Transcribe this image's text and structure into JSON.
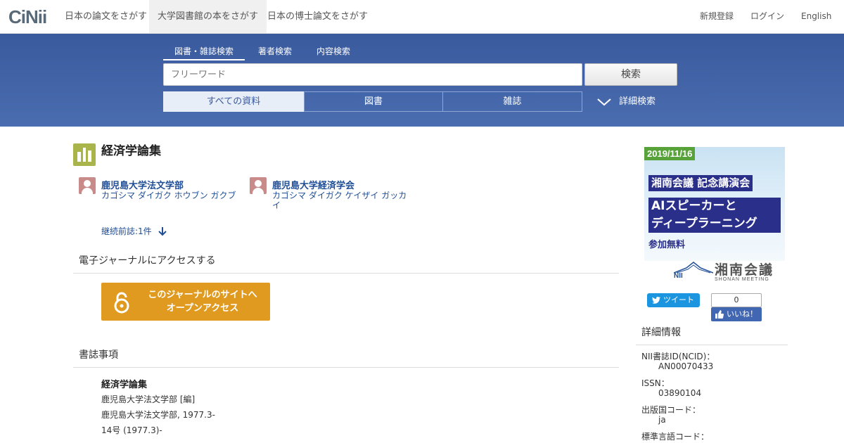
{
  "nav": {
    "logo": "CiNii",
    "tabs": [
      "日本の論文をさがす",
      "大学図書館の本をさがす",
      "日本の博士論文をさがす"
    ],
    "right": [
      "新規登録",
      "ログイン",
      "English"
    ]
  },
  "search": {
    "tabs": [
      "図書・雑誌検索",
      "著者検索",
      "内容検索"
    ],
    "placeholder": "フリーワード",
    "button": "検索",
    "types": [
      "すべての資料",
      "図書",
      "雑誌"
    ],
    "advanced": "詳細検索"
  },
  "record": {
    "title": "経済学論集",
    "authors": [
      {
        "name": "鹿児島大学法文学部",
        "kana": "カゴシマ ダイガク ホウブン ガクブ"
      },
      {
        "name": "鹿児島大学経済学会",
        "kana": "カゴシマ ダイガク ケイザイ ガッカイ"
      }
    ],
    "previous": "継続前誌:1件"
  },
  "ej": {
    "heading": "電子ジャーナルにアクセスする",
    "button_line1": "このジャーナルのサイトへ",
    "button_line2": "オープンアクセス"
  },
  "biblio": {
    "heading": "書誌事項",
    "title": "経済学論集",
    "responsibility": "鹿児島大学法文学部 [編]",
    "publication": "鹿児島大学法文学部, 1977.3-",
    "volume": "14号 (1977.3)-"
  },
  "banner": {
    "date": "2019/11/16",
    "line1": "湘南会議 記念講演会",
    "line2a": "AIスピーカーと",
    "line2b": "ディープラーニング",
    "line3": "参加無料",
    "nii": "NII",
    "shonan": "湘南会議",
    "shonan_en": "SHONAN MEETING"
  },
  "social": {
    "tweet": "ツイート",
    "like_count": "0",
    "like": "いいね！"
  },
  "details": {
    "heading": "詳細情報",
    "items": [
      {
        "key": "NII書誌ID(NCID)：",
        "value": "AN00070433"
      },
      {
        "key": "ISSN：",
        "value": "03890104"
      },
      {
        "key": "出版国コード：",
        "value": "ja"
      },
      {
        "key": "標準言語コード：",
        "value": ""
      }
    ]
  }
}
